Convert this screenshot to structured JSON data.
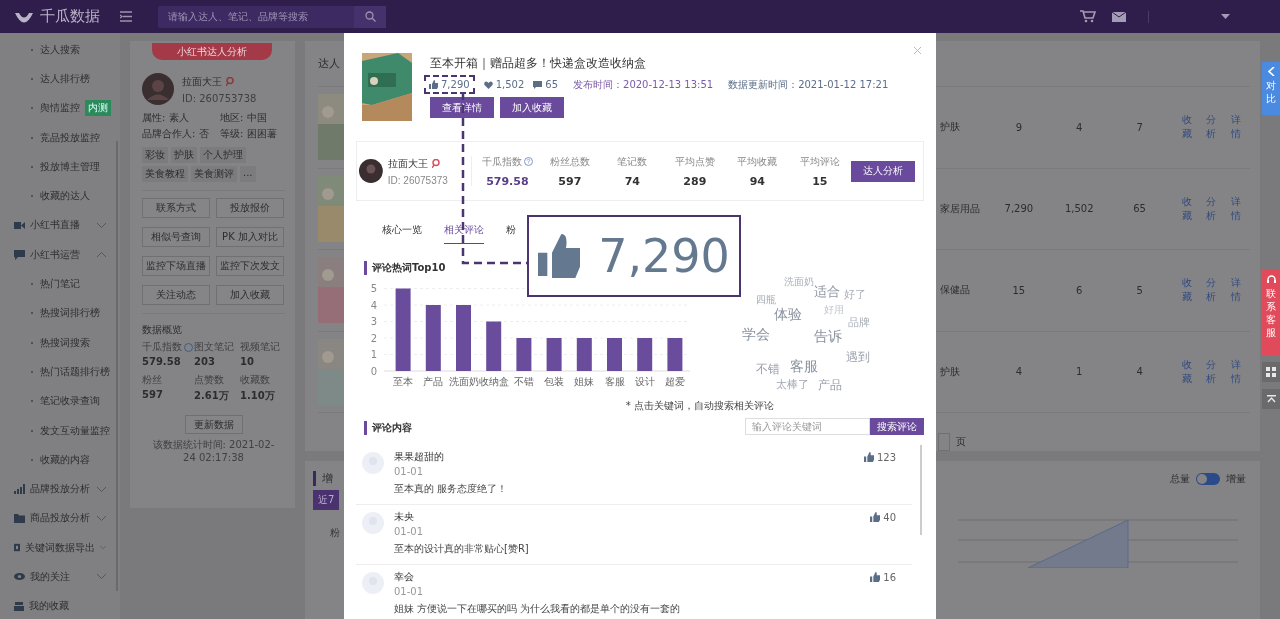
{
  "topbar": {
    "logo": "千瓜数据",
    "search": {
      "placeholder": "请输入达人、笔记、品牌等搜索"
    }
  },
  "sidebar": {
    "items": [
      {
        "kind": "sub",
        "label": "达人搜索"
      },
      {
        "kind": "sub",
        "label": "达人排行榜"
      },
      {
        "kind": "sub",
        "label": "舆情监控",
        "badge": "内测"
      },
      {
        "kind": "sub",
        "label": "竞品投放监控"
      },
      {
        "kind": "sub",
        "label": "投放博主管理"
      },
      {
        "kind": "sub",
        "label": "收藏的达人"
      },
      {
        "kind": "group",
        "label": "小红书直播",
        "expanded": false
      },
      {
        "kind": "group",
        "label": "小红书运营",
        "expanded": true
      },
      {
        "kind": "sub",
        "label": "热门笔记"
      },
      {
        "kind": "sub",
        "label": "热搜词排行榜"
      },
      {
        "kind": "sub",
        "label": "热搜词搜索"
      },
      {
        "kind": "sub",
        "label": "热门话题排行榜"
      },
      {
        "kind": "sub",
        "label": "笔记收录查询"
      },
      {
        "kind": "sub",
        "label": "发文互动量监控"
      },
      {
        "kind": "sub",
        "label": "收藏的内容"
      },
      {
        "kind": "group",
        "label": "品牌投放分析",
        "expanded": false
      },
      {
        "kind": "group",
        "label": "商品投放分析",
        "expanded": false
      },
      {
        "kind": "group",
        "label": "关键词数据导出",
        "expanded": false
      },
      {
        "kind": "group",
        "label": "我的关注",
        "expanded": false
      },
      {
        "kind": "link",
        "label": "我的收藏"
      }
    ]
  },
  "profile_panel": {
    "badge": "小红书达人分析",
    "name": "拉面大王",
    "id": "ID: 260753738",
    "attributes": [
      "属性: 素人",
      "地区: 中国",
      "品牌合作人: 否",
      "等级: 困困薯"
    ],
    "tags": [
      "彩妆",
      "护肤",
      "个人护理",
      "美食教程",
      "美食测评",
      "..."
    ],
    "actions": [
      "联系方式",
      "投放报价",
      "相似号查询",
      "PK 加入对比",
      "监控下场直播",
      "监控下次发文",
      "关注动态",
      "加入收藏"
    ],
    "overview": {
      "title": "数据概览",
      "stats": [
        {
          "label": "千瓜指数",
          "value": "579.58"
        },
        {
          "label": "图文笔记",
          "value": "203"
        },
        {
          "label": "视频笔记",
          "value": "10"
        },
        {
          "label": "粉丝",
          "value": "597"
        },
        {
          "label": "点赞数",
          "value": "2.61万"
        },
        {
          "label": "收藏数",
          "value": "1.10万"
        }
      ]
    },
    "refresh_button": "更新数据",
    "stat_time": "该数据统计时间: 2021-02-24 02:17:38"
  },
  "main": {
    "header": "达人",
    "rows": [
      {
        "column_2": "护肤",
        "column_3": "9",
        "column_4": "4",
        "column_5": "7",
        "actions": [
          "收藏",
          "分析",
          "详情"
        ]
      },
      {
        "column_2": "家居用品",
        "column_3": "7,290",
        "column_4": "1,502",
        "column_5": "65",
        "actions": [
          "收藏",
          "分析",
          "详情"
        ]
      },
      {
        "column_2": "保健品",
        "column_3": "15",
        "column_4": "6",
        "column_5": "5",
        "actions": [
          "收藏",
          "分析",
          "详情"
        ]
      },
      {
        "column_2": "护肤",
        "column_3": "4",
        "column_4": "1",
        "column_5": "4",
        "actions": [
          "收藏",
          "分析",
          "详情"
        ]
      }
    ],
    "pagination": {
      "suffix": "页"
    },
    "growth": {
      "title": "增",
      "range_button": "近7",
      "axis_label": "粉",
      "toggle": {
        "left": "总量",
        "right": "增量",
        "on": false
      }
    }
  },
  "floating": {
    "compare": "对比",
    "service": "联系客服"
  },
  "modal": {
    "note": {
      "title": "至本开箱｜赠品超多！快递盒改造收纳盒",
      "likes": "7,290",
      "hearts": "1,502",
      "comments": "65",
      "published": "发布时间：2020-12-13 13:51",
      "updated": "数据更新时间：2021-01-12 17:21",
      "buttons": [
        "查看详情",
        "加入收藏"
      ]
    },
    "author": {
      "name": "拉面大王",
      "id": "ID: 26075373",
      "metrics": [
        {
          "label": "千瓜指数",
          "value": "579.58"
        },
        {
          "label": "粉丝总数",
          "value": "597"
        },
        {
          "label": "笔记数",
          "value": "74"
        },
        {
          "label": "平均点赞",
          "value": "289"
        },
        {
          "label": "平均收藏",
          "value": "94"
        },
        {
          "label": "平均评论",
          "value": "15"
        }
      ],
      "button": "达人分析"
    },
    "tabs": [
      {
        "label": "核心一览",
        "selected": false
      },
      {
        "label": "相关评论",
        "selected": true
      },
      {
        "label": "粉",
        "selected": false
      }
    ],
    "hot_words": {
      "chart_data": {
        "type": "bar",
        "title": "评论热词Top10",
        "categories": [
          "至本",
          "产品",
          "洗面奶",
          "收纳盒",
          "不错",
          "包装",
          "姐妹",
          "客服",
          "设计",
          "超爱"
        ],
        "values": [
          5,
          4,
          4,
          3,
          2,
          2,
          2,
          2,
          2,
          2
        ],
        "ylim": [
          0,
          5
        ],
        "yticks": [
          0,
          1,
          2,
          3,
          4,
          5
        ],
        "grid": true
      },
      "word_cloud": [
        "洗面奶",
        "适合",
        "好了",
        "四瓶",
        "好用",
        "体验",
        "品牌",
        "学会",
        "告诉",
        "遇到",
        "不错",
        "客服",
        "太棒了",
        "产品"
      ],
      "hint": "* 点击关键词，自动搜索相关评论"
    },
    "comments": {
      "title": "评论内容",
      "search": {
        "placeholder": "输入评论关键词",
        "button": "搜索评论"
      },
      "items": [
        {
          "user": "果果超甜的",
          "date": "01-01",
          "text": "至本真的 服务态度绝了！",
          "likes": "123"
        },
        {
          "user": "未央",
          "date": "01-01",
          "text": "至本的设计真的非常贴心[赞R]",
          "likes": "40"
        },
        {
          "user": "幸会",
          "date": "01-01",
          "text": "姐妹 方便说一下在哪买的吗 为什么我看的都是单个的没有一套的",
          "likes": "16"
        }
      ]
    },
    "callout": {
      "value": "7,290"
    }
  }
}
